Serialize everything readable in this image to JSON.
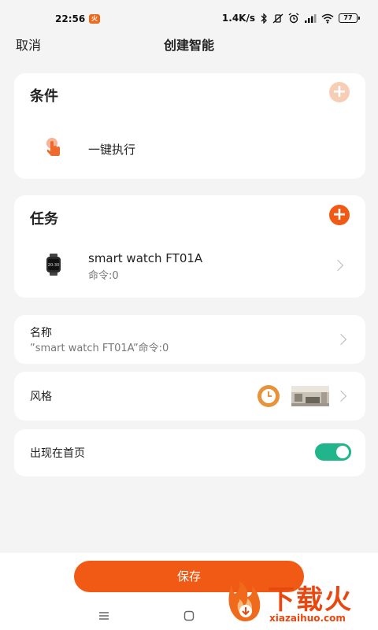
{
  "status_bar": {
    "time": "22:56",
    "app_badge": "火",
    "net_speed": "1.4K/s",
    "battery": "77"
  },
  "nav": {
    "cancel": "取消",
    "title": "创建智能"
  },
  "condition_card": {
    "title": "条件",
    "item_label": "一键执行"
  },
  "task_card": {
    "title": "任务",
    "device_name": "smart watch   FT01A",
    "command": "命令:0",
    "watch_screen_text": "20:30"
  },
  "name_card": {
    "label": "名称",
    "value": "”smart watch   FT01A”命令:0"
  },
  "style_card": {
    "label": "风格"
  },
  "home_card": {
    "label": "出现在首页",
    "toggle_on": true
  },
  "save_button": "保存",
  "watermark": {
    "text": "下载火",
    "url": "xiazaihuo.com"
  },
  "colors": {
    "accent": "#f05a14",
    "toggle_on": "#20b58a",
    "add_disabled": "#f8cdb6"
  }
}
